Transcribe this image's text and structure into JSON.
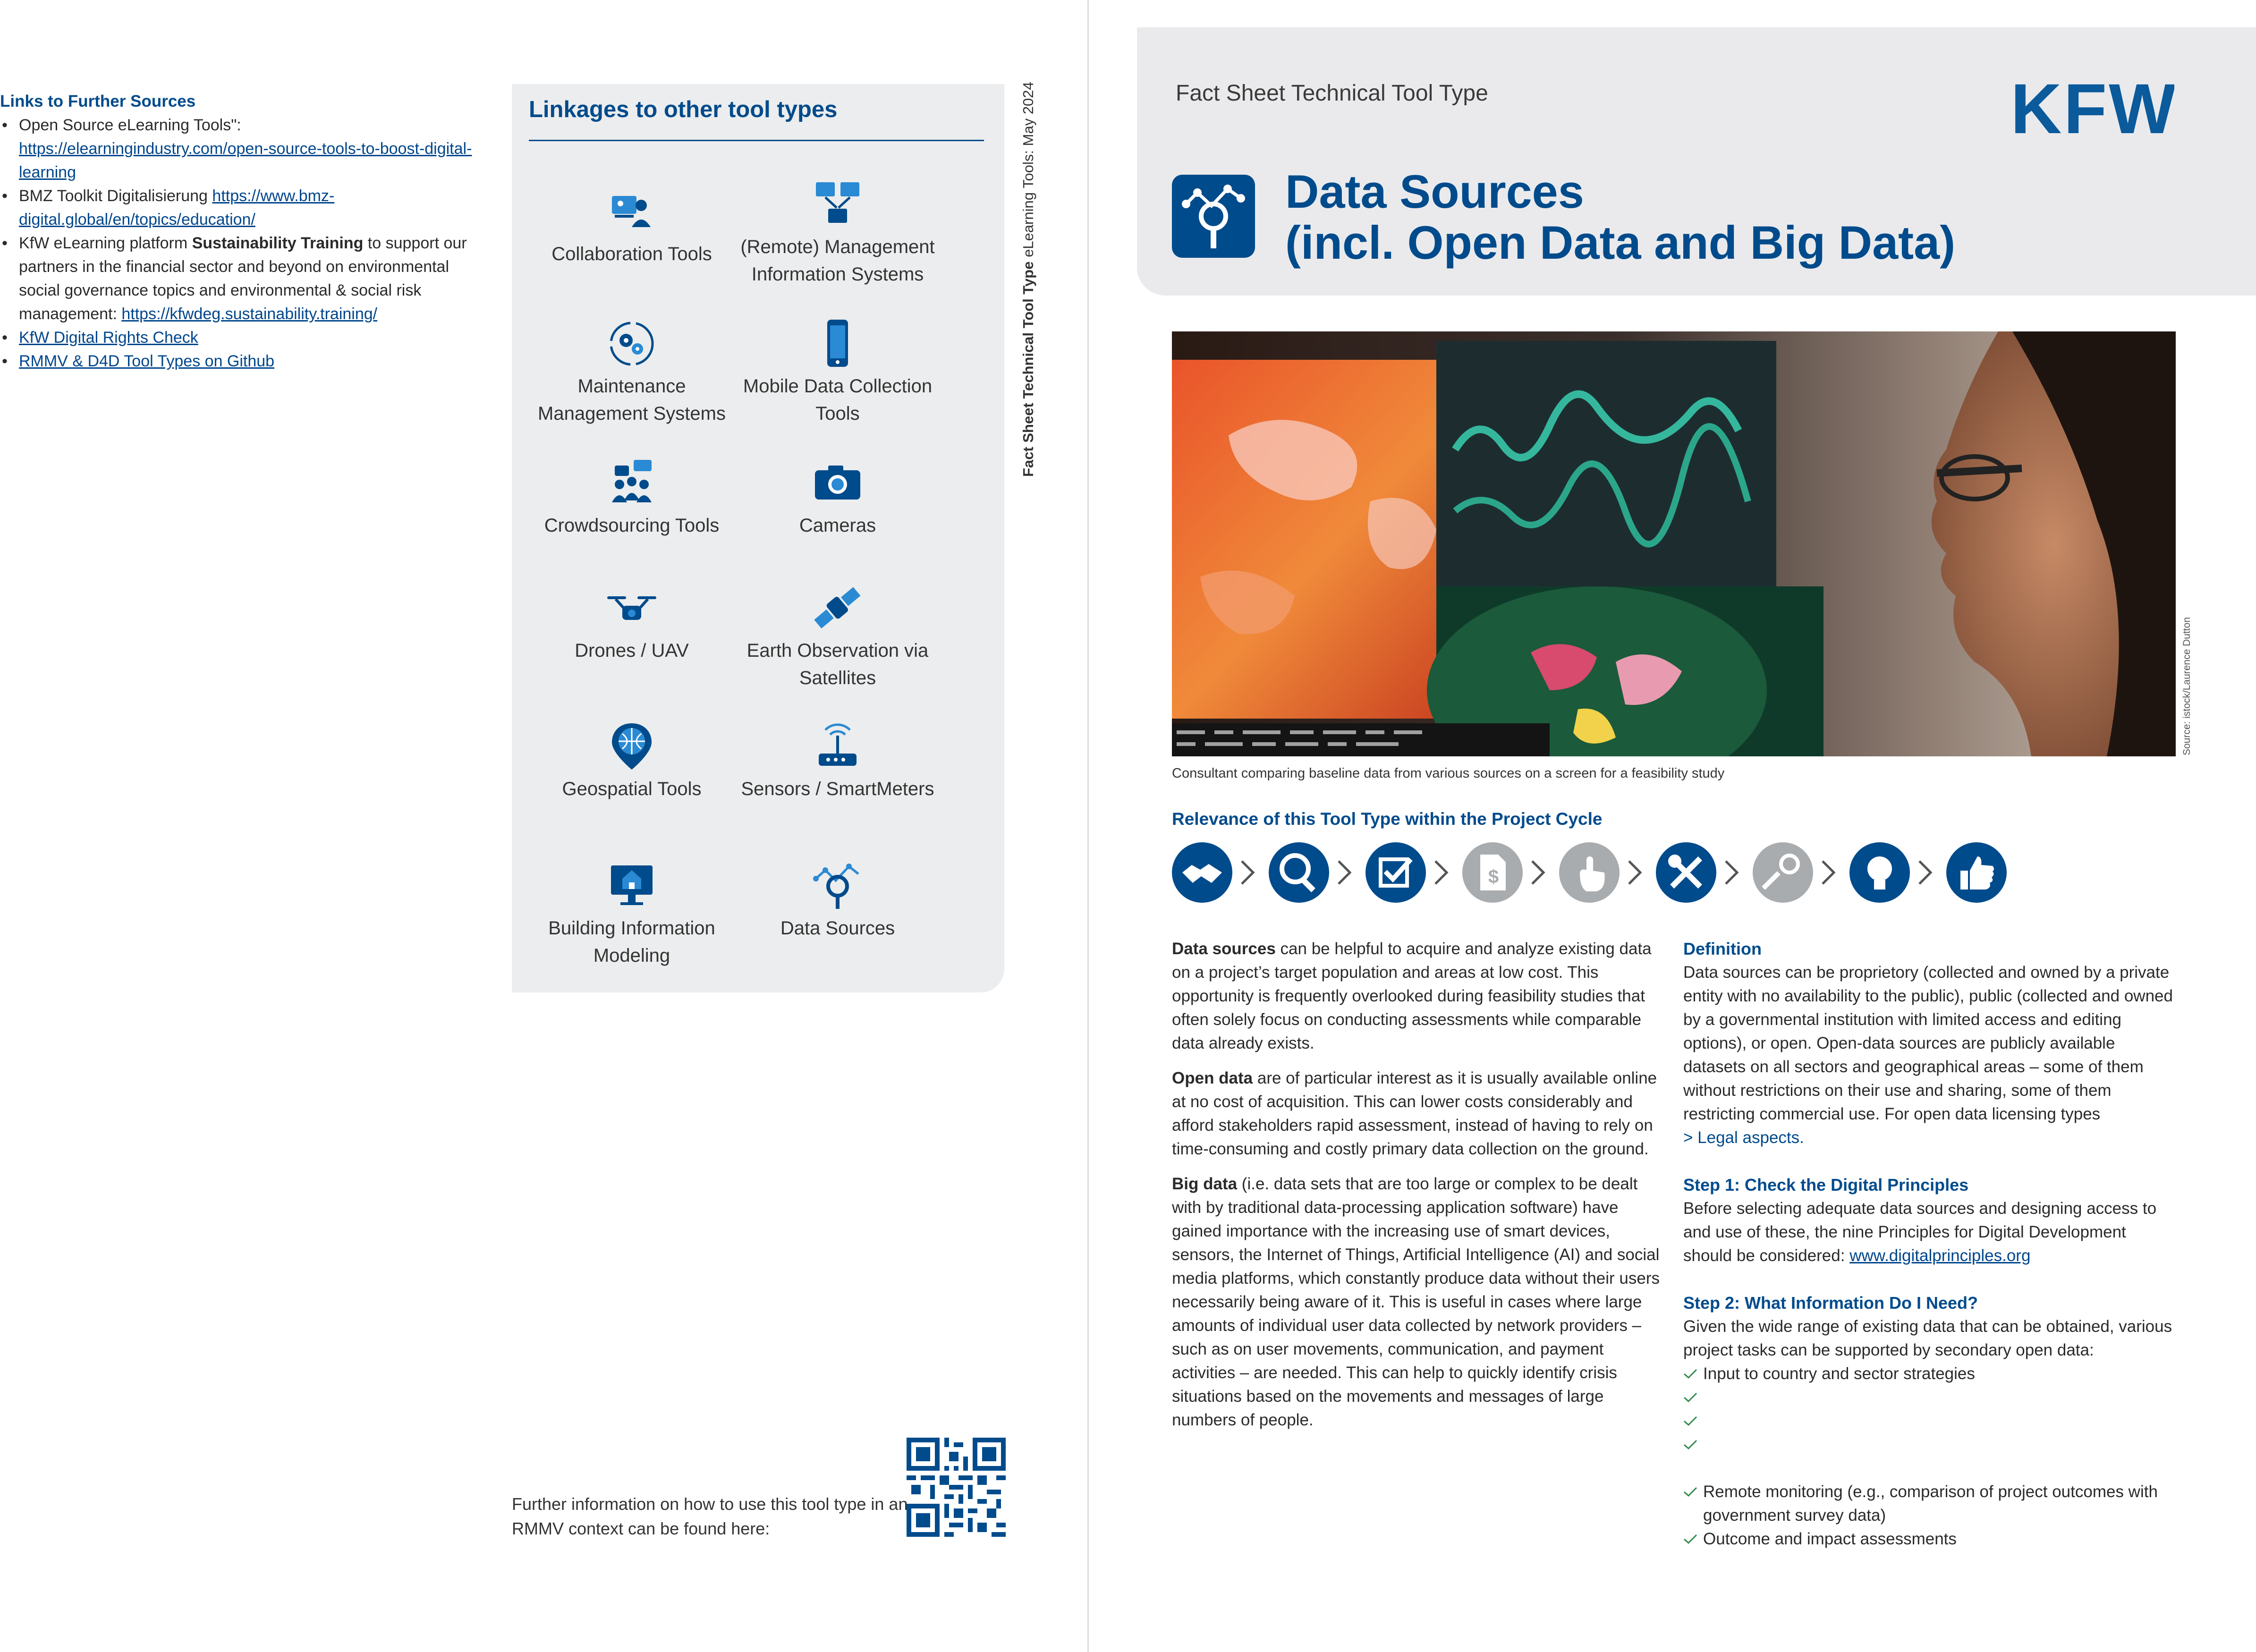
{
  "left_page": {
    "links_heading": "Links to Further Sources",
    "links": [
      {
        "prefix": "Open Source eLearning Tools\": ",
        "link": "https://elearningindustry.com/open-source-tools-to-boost-digital-learning"
      },
      {
        "prefix": "BMZ Toolkit Digitalisierung ",
        "link": "https://www.bmz-digital.global/en/topics/education/"
      },
      {
        "prefix": "KfW eLearning platform ",
        "bold": "Sustainability Training",
        "suffix": " to support our partners in the financial sector and beyond on environmental social governance topics and environmental & social risk management: ",
        "link": "https://kfwdeg.sustainability.training/"
      },
      {
        "link": "KfW Digital Rights Check"
      },
      {
        "link": "RMMV & D4D Tool Types on Github"
      }
    ],
    "linkages_title": "Linkages to other tool types",
    "tools": [
      {
        "label": "Collaboration Tools",
        "icon": "collaboration-icon"
      },
      {
        "label": "(Remote) Management Information Systems",
        "icon": "management-information-icon"
      },
      {
        "label": "Maintenance Management Systems",
        "icon": "maintenance-icon"
      },
      {
        "label": "Mobile Data Collection Tools",
        "icon": "mobile-phone-icon"
      },
      {
        "label": "Crowdsourcing Tools",
        "icon": "crowdsourcing-icon"
      },
      {
        "label": "Cameras",
        "icon": "camera-icon"
      },
      {
        "label": "Drones / UAV",
        "icon": "drone-icon"
      },
      {
        "label": "Earth Observation via Satellites",
        "icon": "satellite-icon"
      },
      {
        "label": "Geospatial Tools",
        "icon": "globe-pin-icon"
      },
      {
        "label": "Sensors / SmartMeters",
        "icon": "sensor-icon"
      },
      {
        "label": "Building Information Modeling",
        "icon": "building-monitor-icon"
      },
      {
        "label": "Data Sources",
        "icon": "data-sources-icon"
      }
    ],
    "vertical_label_bold": "Fact Sheet Technical Tool Type",
    "vertical_label_rest": " eLearning Tools: May 2024",
    "further_info": "Further information on how to use this tool type in an RMMV context can be found here:"
  },
  "right_page": {
    "fact_sheet_label": "Fact Sheet Technical Tool Type",
    "logo_text": "KFW",
    "title_line1": "Data Sources",
    "title_line2": "(incl. Open Data and Big Data)",
    "photo_credit": "Source: istock/Laurence Dutton",
    "caption": "Consultant comparing baseline data from various sources on a screen for a feasibility study",
    "relevance_heading": "Relevance of this Tool Type within the Project Cycle",
    "cycle_steps": [
      {
        "icon": "handshake-icon",
        "active": true
      },
      {
        "icon": "magnifier-icon",
        "active": true
      },
      {
        "icon": "checkbox-icon",
        "active": true
      },
      {
        "icon": "finance-document-icon",
        "active": false
      },
      {
        "icon": "hand-pointer-icon",
        "active": false
      },
      {
        "icon": "tools-icon",
        "active": true
      },
      {
        "icon": "keys-icon",
        "active": false
      },
      {
        "icon": "lightbulb-icon",
        "active": true
      },
      {
        "icon": "thumbs-up-icon",
        "active": true
      }
    ],
    "colors": {
      "active": "#004b8c",
      "inactive": "#a9acaf"
    },
    "left_column": {
      "p1_bold": "Data sources",
      "p1": " can be helpful to acquire and analyze existing data on a project’s target population and areas at low cost. This opportunity is frequently overlooked during feasibility studies that often solely focus on conducting assessments while comparable data already exists.",
      "p2_bold": "Open data",
      "p2": " are of particular interest as it is usually available online at no cost of acquisition. This can lower costs considerably and afford stakeholders rapid assessment, instead of having to rely on time-consuming and costly primary data collection on the ground.",
      "p3_bold": "Big data",
      "p3": " (i.e. data sets that are too large or complex to be dealt with by traditional data-processing application software) have gained importance with the increasing use of smart devices, sensors, the Internet of Things, Artificial Intelligence (AI) and social media platforms, which constantly produce data without their users necessarily being aware of it. This is useful in cases where large amounts of individual user data collected by network providers – such as on user movements, communication, and payment activities – are needed. This can help to quickly identify crisis situations based on the movements and messages of large numbers of people."
    },
    "right_column": {
      "definition_heading": "Definition",
      "definition": "Data sources can be proprietory (collected and owned by a private entity with no availability to the public), public (collected and owned by a governmental institution with limited access and editing options), or open. Open-data sources are publicly available datasets on all sectors and geographical areas – some of them without restrictions on their use and sharing, some of them restricting commercial use. For open data licensing types ",
      "definition_link": "> Legal aspects.",
      "step1_heading": "Step 1: Check the Digital Principles",
      "step1": "Before selecting adequate data sources and designing access to and use of these, the nine Principles for Digital Development should be considered: ",
      "step1_link": "www.digitalprinciples.org",
      "step2_heading": "Step 2: What Information Do I Need?",
      "step2": "Given the wide range of existing data that can be obtained, various project tasks can be supported by secondary open data:",
      "checks_top": [
        "Input to country and sector strategies",
        "",
        "",
        ""
      ],
      "checks_bottom": [
        "Remote monitoring (e.g., comparison of project outcomes with government survey data)",
        "Outcome and impact assessments"
      ]
    }
  }
}
